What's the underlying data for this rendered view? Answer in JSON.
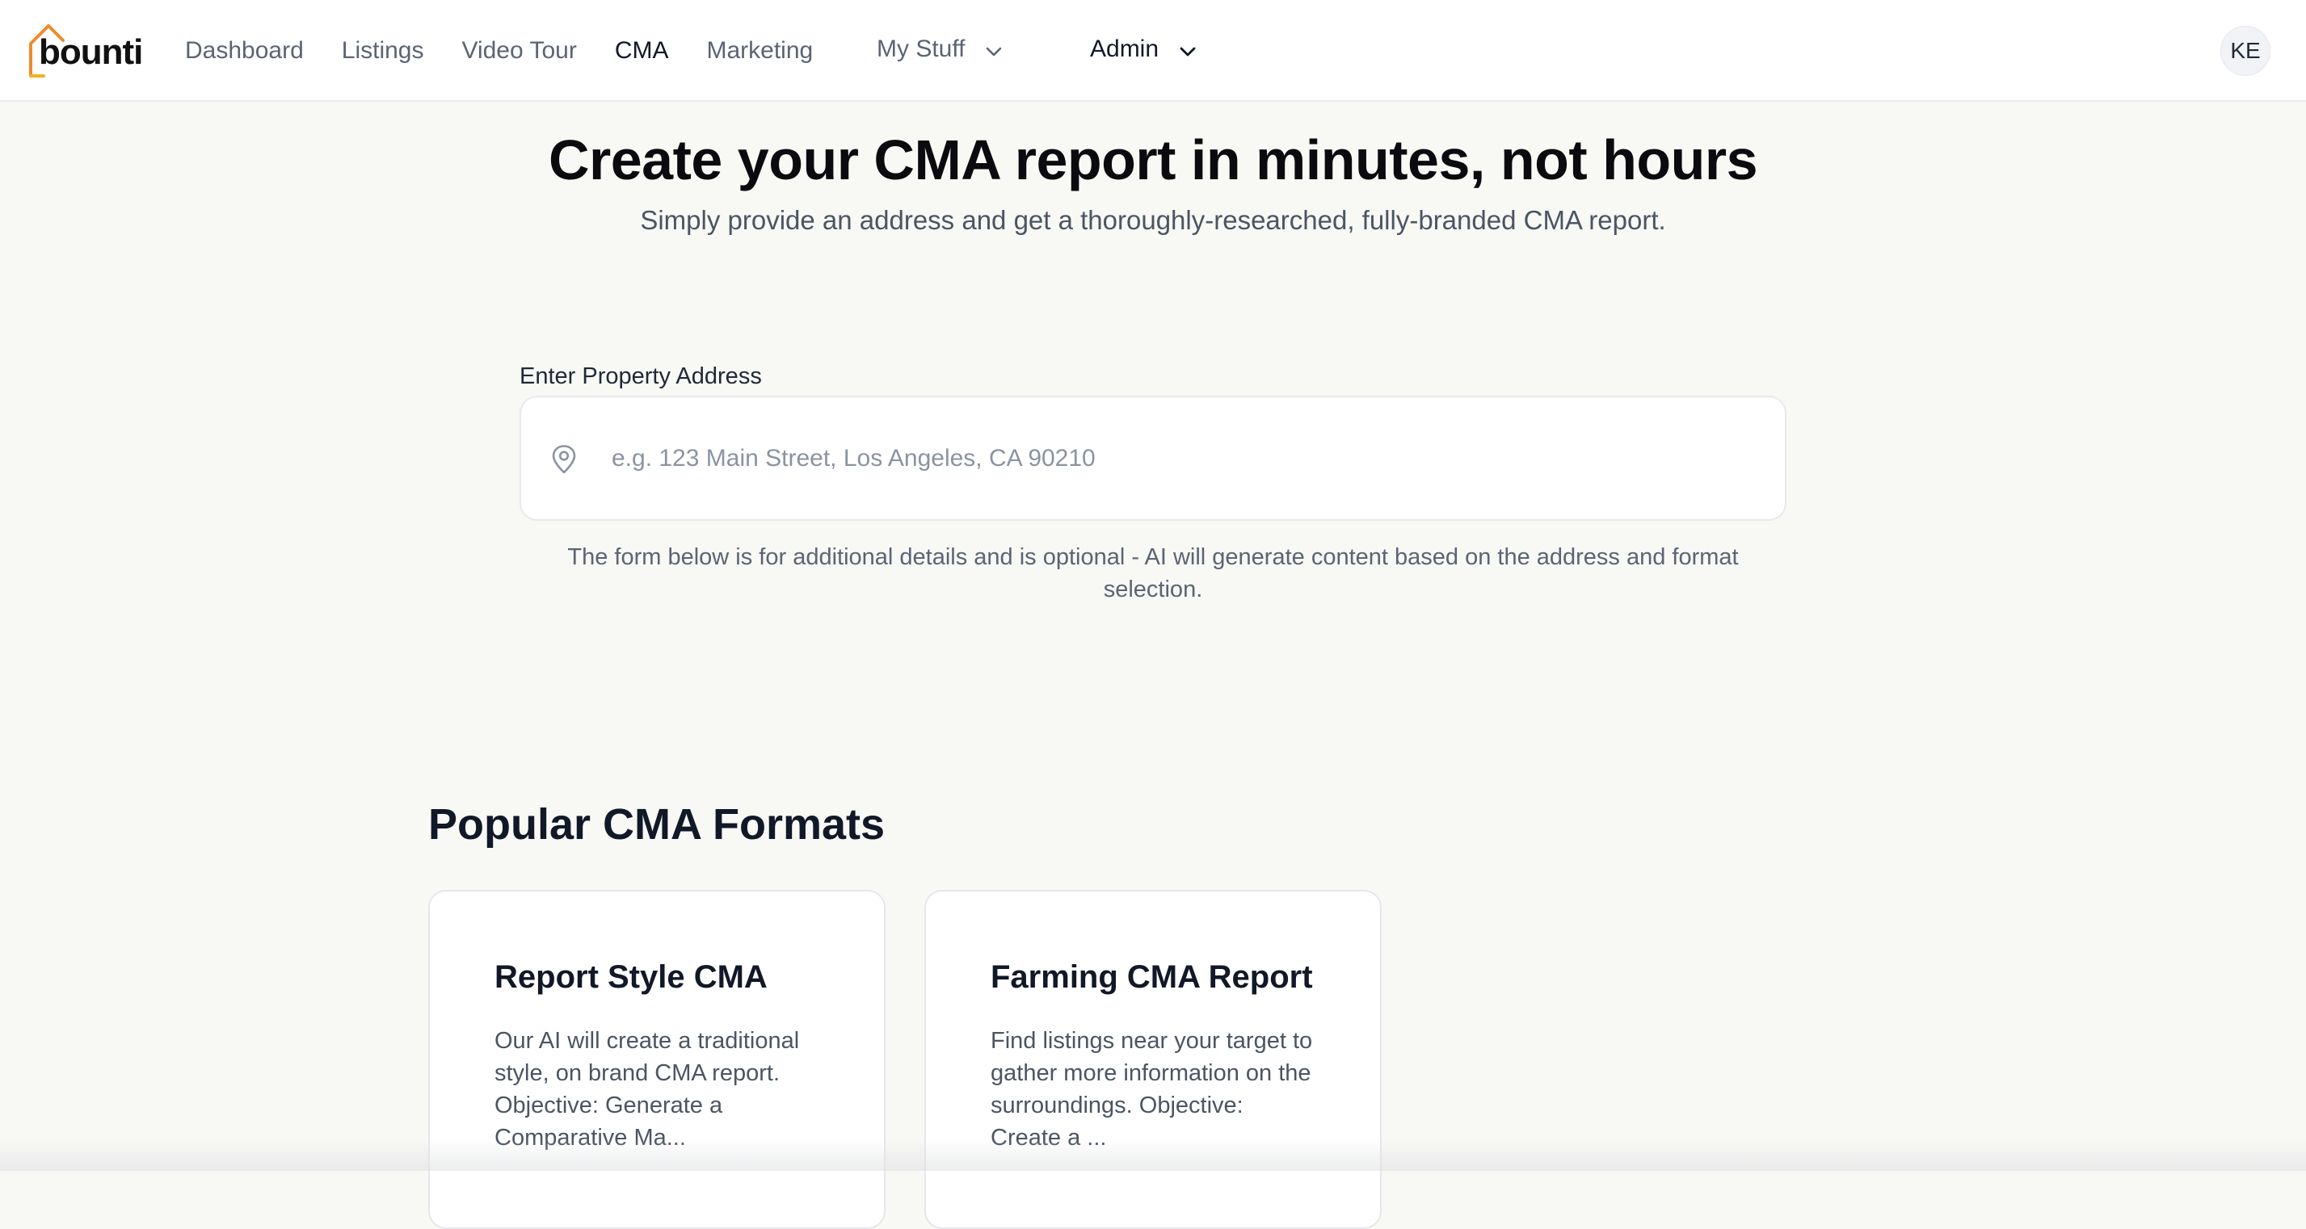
{
  "brand": {
    "name": "bounti",
    "accent": "#f08a2c"
  },
  "nav": {
    "links": [
      {
        "label": "Dashboard"
      },
      {
        "label": "Listings"
      },
      {
        "label": "Video Tour"
      },
      {
        "label": "CMA"
      },
      {
        "label": "Marketing"
      }
    ],
    "my_stuff": "My Stuff",
    "admin": "Admin",
    "avatar_initials": "KE"
  },
  "hero": {
    "title": "Create your CMA report in minutes, not hours",
    "subtitle": "Simply provide an address and get a thoroughly-researched, fully-branded CMA report."
  },
  "address": {
    "label": "Enter Property Address",
    "placeholder": "e.g. 123 Main Street, Los Angeles, CA 90210",
    "value": "",
    "note": "The form below is for additional details and is optional - AI will generate content based on the address and format selection."
  },
  "formats": {
    "title": "Popular CMA Formats",
    "cards": [
      {
        "title": "Report Style CMA",
        "description": "Our AI will create a traditional style, on brand CMA report. Objective: Generate a Comparative Ma..."
      },
      {
        "title": "Farming CMA Report",
        "description": "Find listings near your target to gather more information on the surroundings. Objective: Create a ..."
      }
    ]
  },
  "icons": {
    "logo": "house-outline-icon",
    "chevron": "chevron-down-icon",
    "pin": "map-pin-icon"
  }
}
